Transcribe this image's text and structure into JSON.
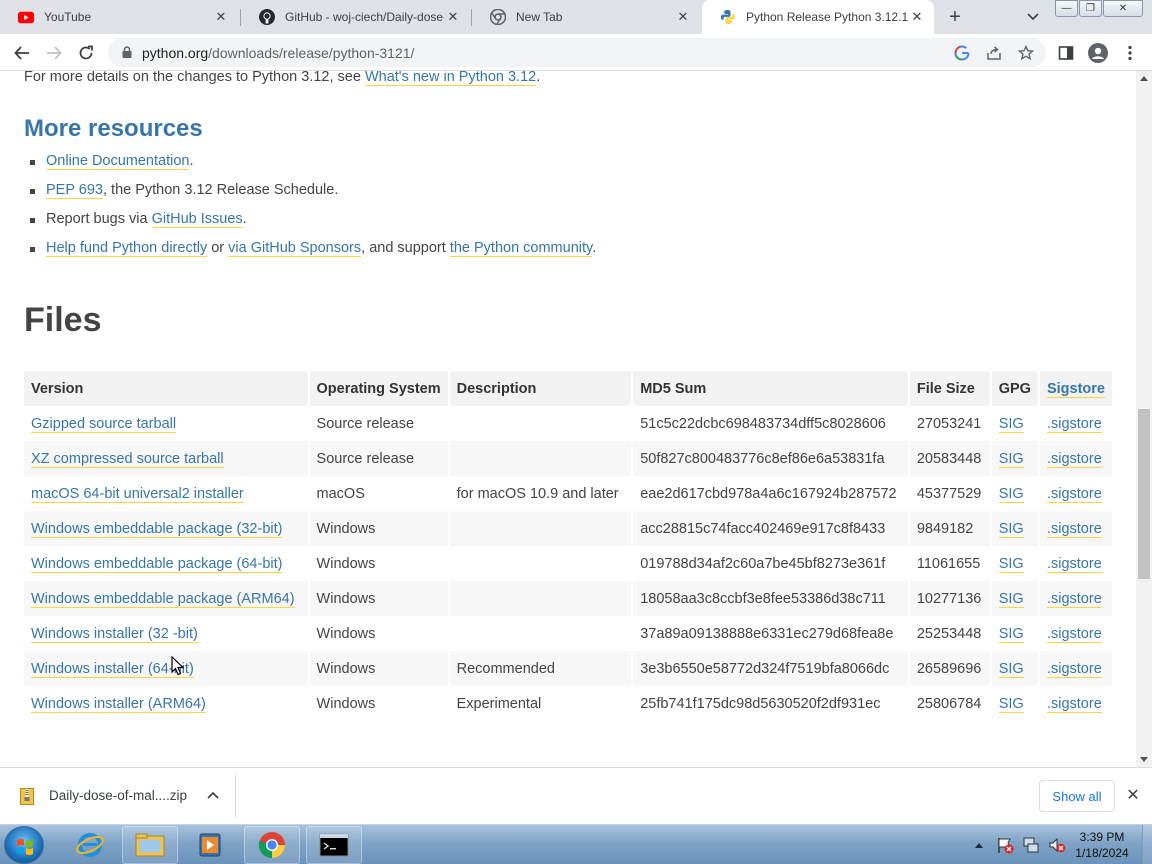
{
  "tabs": [
    {
      "title": "YouTube",
      "icon": "youtube-icon",
      "active": false
    },
    {
      "title": "GitHub - woj-ciech/Daily-dose-",
      "icon": "github-icon",
      "active": false
    },
    {
      "title": "New Tab",
      "icon": "chrome-icon",
      "active": false
    },
    {
      "title": "Python Release Python 3.12.1 |",
      "icon": "python-icon",
      "active": true
    }
  ],
  "address_bar": {
    "host": "python.org",
    "path": "/downloads/release/python-3121/"
  },
  "page": {
    "intro_prefix": "For more details on the changes to Python 3.12, see ",
    "intro_link": "What's new in Python 3.12",
    "intro_suffix": ".",
    "more_resources_heading": "More resources",
    "resources": [
      {
        "parts": [
          {
            "text": "Online Documentation",
            "link": true
          },
          {
            "text": ".",
            "link": false
          }
        ]
      },
      {
        "parts": [
          {
            "text": "PEP 693",
            "link": true
          },
          {
            "text": ", the Python 3.12 Release Schedule.",
            "link": false
          }
        ]
      },
      {
        "parts": [
          {
            "text": "Report bugs via ",
            "link": false
          },
          {
            "text": "GitHub Issues",
            "link": true
          },
          {
            "text": ".",
            "link": false
          }
        ]
      },
      {
        "parts": [
          {
            "text": "Help fund Python directly",
            "link": true
          },
          {
            "text": " or ",
            "link": false
          },
          {
            "text": "via GitHub Sponsors",
            "link": true
          },
          {
            "text": ", and support ",
            "link": false
          },
          {
            "text": "the Python community",
            "link": true
          },
          {
            "text": ".",
            "link": false
          }
        ]
      }
    ],
    "files_heading": "Files",
    "table": {
      "headers": [
        "Version",
        "Operating System",
        "Description",
        "MD5 Sum",
        "File Size",
        "GPG",
        "Sigstore"
      ],
      "rows": [
        [
          "Gzipped source tarball",
          "Source release",
          "",
          "51c5c22dcbc698483734dff5c8028606",
          "27053241",
          "SIG",
          ".sigstore"
        ],
        [
          "XZ compressed source tarball",
          "Source release",
          "",
          "50f827c800483776c8ef86e6a53831fa",
          "20583448",
          "SIG",
          ".sigstore"
        ],
        [
          "macOS 64-bit universal2 installer",
          "macOS",
          "for macOS 10.9 and later",
          "eae2d617cbd978a4a6c167924b287572",
          "45377529",
          "SIG",
          ".sigstore"
        ],
        [
          "Windows embeddable package (32-bit)",
          "Windows",
          "",
          "acc28815c74facc402469e917c8f8433",
          "9849182",
          "SIG",
          ".sigstore"
        ],
        [
          "Windows embeddable package (64-bit)",
          "Windows",
          "",
          "019788d34af2c60a7be45bf8273e361f",
          "11061655",
          "SIG",
          ".sigstore"
        ],
        [
          "Windows embeddable package (ARM64)",
          "Windows",
          "",
          "18058aa3c8ccbf3e8fee53386d38c711",
          "10277136",
          "SIG",
          ".sigstore"
        ],
        [
          "Windows installer (32 -bit)",
          "Windows",
          "",
          "37a89a09138888e6331ec279d68fea8e",
          "25253448",
          "SIG",
          ".sigstore"
        ],
        [
          "Windows installer (64-bit)",
          "Windows",
          "Recommended",
          "3e3b6550e58772d324f7519bfa8066dc",
          "26589696",
          "SIG",
          ".sigstore"
        ],
        [
          "Windows installer (ARM64)",
          "Windows",
          "Experimental",
          "25fb741f175dc98d5630520f2df931ec",
          "25806784",
          "SIG",
          ".sigstore"
        ]
      ]
    }
  },
  "download_bar": {
    "file_name": "Daily-dose-of-mal....zip",
    "show_all_label": "Show all"
  },
  "taskbar": {
    "time": "3:39 PM",
    "date": "1/18/2024"
  },
  "colors": {
    "link": "#3776ab",
    "link_underline": "#ffd343",
    "heading": "#3776ab",
    "taskbar": "#7fa3c6"
  }
}
